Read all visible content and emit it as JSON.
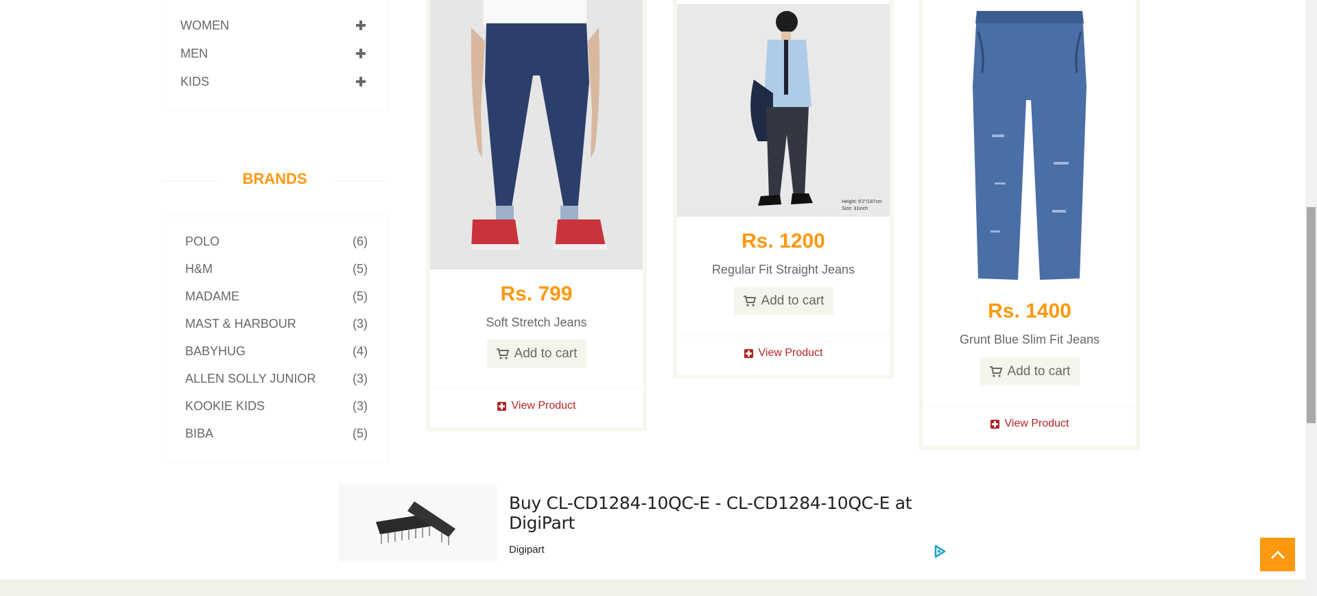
{
  "categories": [
    {
      "label": "WOMEN"
    },
    {
      "label": "MEN"
    },
    {
      "label": "KIDS"
    }
  ],
  "brands": {
    "title": "BRANDS",
    "items": [
      {
        "name": "POLO",
        "count": "(6)"
      },
      {
        "name": "H&M",
        "count": "(5)"
      },
      {
        "name": "MADAME",
        "count": "(5)"
      },
      {
        "name": "MAST & HARBOUR",
        "count": "(3)"
      },
      {
        "name": "BABYHUG",
        "count": "(4)"
      },
      {
        "name": "ALLEN SOLLY JUNIOR",
        "count": "(3)"
      },
      {
        "name": "KOOKIE KIDS",
        "count": "(3)"
      },
      {
        "name": "BIBA",
        "count": "(5)"
      }
    ]
  },
  "products": [
    {
      "price": "Rs. 799",
      "name": "Soft Stretch Jeans",
      "add_to_cart": "Add to cart",
      "view": "View Product"
    },
    {
      "price": "Rs. 1200",
      "name": "Regular Fit Straight Jeans",
      "add_to_cart": "Add to cart",
      "view": "View Product",
      "image_caption_1": "Height: 6'2\"/187cm",
      "image_caption_2": "Size: 31inch"
    },
    {
      "price": "Rs. 1400",
      "name": "Grunt Blue Slim Fit Jeans",
      "add_to_cart": "Add to cart",
      "view": "View Product"
    }
  ],
  "ad": {
    "title": "Buy CL-CD1284-10QC-E - CL-CD1284-10QC-E at DigiPart",
    "source": "Digipart"
  },
  "colors": {
    "accent": "#fe980f",
    "link": "#b4211f",
    "text": "#696763"
  }
}
